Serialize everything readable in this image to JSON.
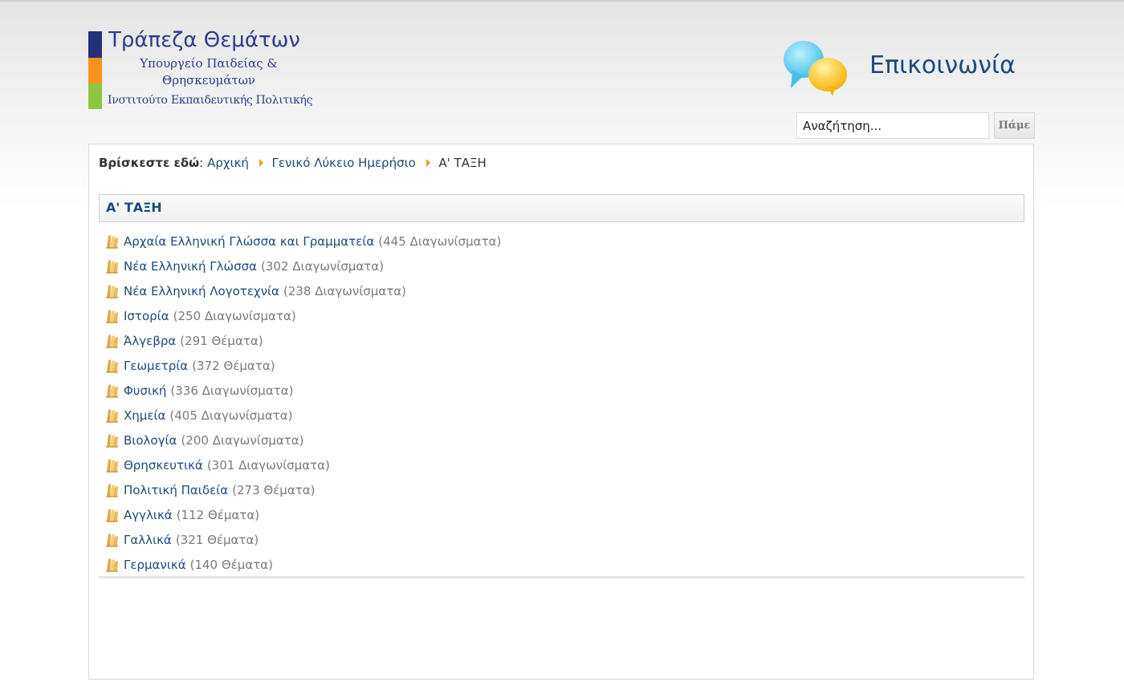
{
  "logo": {
    "title": "Τράπεζα Θεμάτων",
    "subtitle_line1": "Υπουργείο Παιδείας &",
    "subtitle_line2": "Θρησκευμάτων",
    "institute": "Ινστιτούτο Εκπαιδευτικής Πολιτικής",
    "colors": [
      "#23307a",
      "#f7931e",
      "#8dc63f"
    ]
  },
  "contact": {
    "label": "Επικοινωνία",
    "icon": "speech-bubbles-icon"
  },
  "search": {
    "placeholder": "Αναζήτηση...",
    "button_label": "Πάμε"
  },
  "breadcrumb": {
    "label": "Βρίσκεστε εδώ",
    "items": [
      "Αρχική",
      "Γενικό Λύκειο Ημερήσιο"
    ],
    "current": "Α' ΤΑΞΗ"
  },
  "category": {
    "title": "Α' ΤΑΞΗ",
    "subjects": [
      {
        "name": "Αρχαία Ελληνική Γλώσσα και Γραμματεία",
        "count": "(445 Διαγωνίσματα)"
      },
      {
        "name": "Νέα Ελληνική Γλώσσα",
        "count": "(302 Διαγωνίσματα)"
      },
      {
        "name": "Νέα Ελληνική Λογοτεχνία",
        "count": "(238 Διαγωνίσματα)"
      },
      {
        "name": "Ιστορία",
        "count": "(250 Διαγωνίσματα)"
      },
      {
        "name": "Άλγεβρα",
        "count": "(291 Θέματα)"
      },
      {
        "name": "Γεωμετρία",
        "count": "(372 Θέματα)"
      },
      {
        "name": "Φυσική",
        "count": "(336 Διαγωνίσματα)"
      },
      {
        "name": "Χημεία",
        "count": "(405 Διαγωνίσματα)"
      },
      {
        "name": "Βιολογία",
        "count": "(200 Διαγωνίσματα)"
      },
      {
        "name": "Θρησκευτικά",
        "count": "(301 Διαγωνίσματα)"
      },
      {
        "name": "Πολιτική Παιδεία",
        "count": "(273 Θέματα)"
      },
      {
        "name": "Αγγλικά",
        "count": "(112 Θέματα)"
      },
      {
        "name": "Γαλλικά",
        "count": "(321 Θέματα)"
      },
      {
        "name": "Γερμανικά",
        "count": "(140 Θέματα)"
      }
    ]
  },
  "colors": {
    "link": "#1d4a7c",
    "muted": "#7a7a7a",
    "breadcrumb_arrow": "#f39a1e"
  }
}
